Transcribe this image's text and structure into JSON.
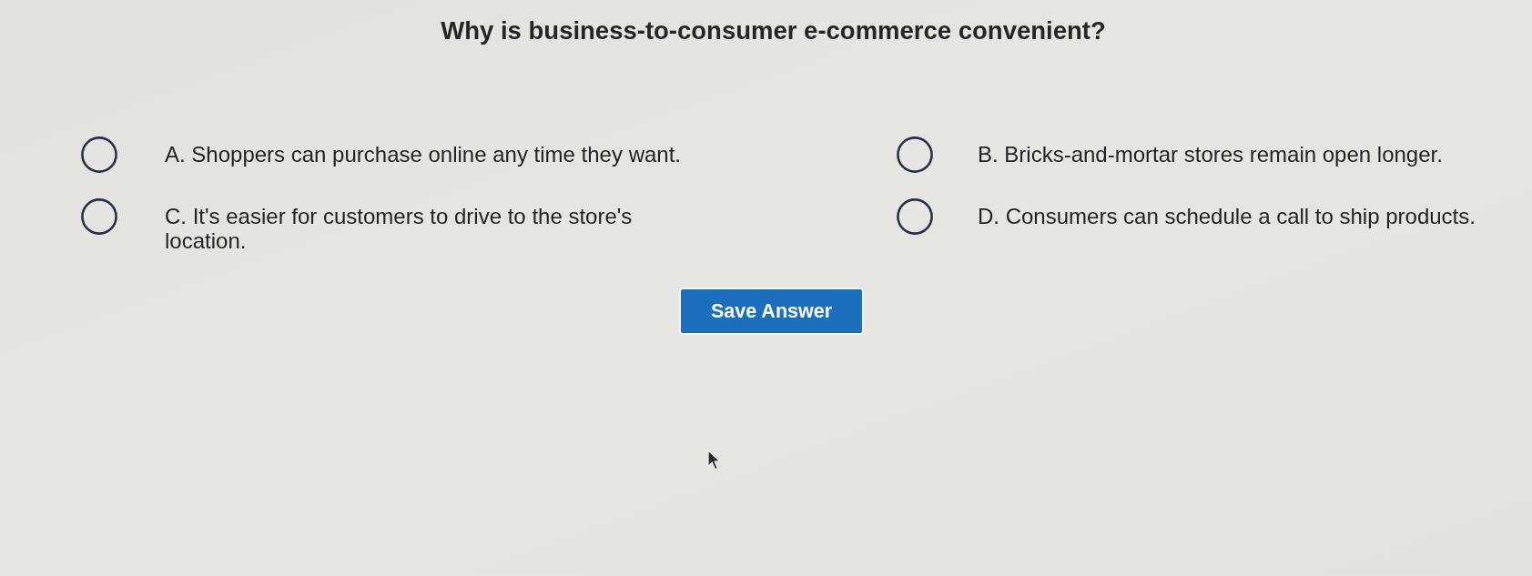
{
  "question": {
    "text": "Why is business-to-consumer e-commerce convenient?"
  },
  "options": [
    {
      "label": "A. Shoppers can purchase online any time they want.",
      "selected": false
    },
    {
      "label": "B. Bricks-and-mortar stores remain open longer.",
      "selected": false
    },
    {
      "label": "C. It's easier for customers to drive to the store's location.",
      "selected": false
    },
    {
      "label": "D. Consumers can schedule a call to ship products.",
      "selected": false
    }
  ],
  "save_button": {
    "label": "Save Answer"
  }
}
